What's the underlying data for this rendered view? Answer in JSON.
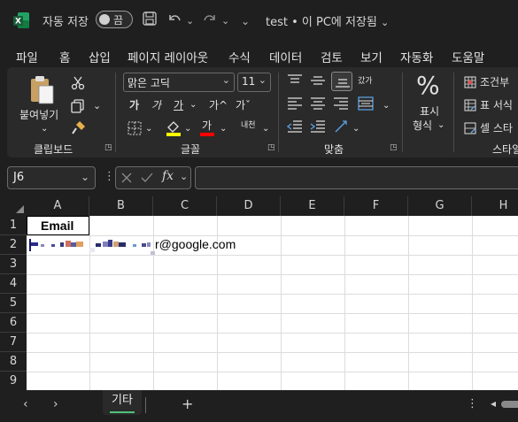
{
  "titlebar": {
    "app_icon": "excel-logo-icon",
    "autosave_label": "자동 저장",
    "autosave_state": "끔",
    "doc_title": "test • 이 PC에 저장됨",
    "title_chevron": "⌄"
  },
  "menu": {
    "tabs": [
      {
        "label": "파일"
      },
      {
        "label": "홈",
        "active": true
      },
      {
        "label": "삽입"
      },
      {
        "label": "페이지 레이아웃"
      },
      {
        "label": "수식"
      },
      {
        "label": "데이터"
      },
      {
        "label": "검토"
      },
      {
        "label": "보기"
      },
      {
        "label": "자동화"
      },
      {
        "label": "도움말"
      }
    ]
  },
  "ribbon": {
    "clipboard": {
      "paste_label": "붙여넣기",
      "group_label": "클립보드"
    },
    "font": {
      "font_name": "맑은 고딕",
      "font_size": "11",
      "bold": "가",
      "italic": "가",
      "underline": "가",
      "grow": "가^",
      "shrink": "가ˇ",
      "font_color_glyph": "가",
      "phonetic": "내천",
      "group_label": "글꼴",
      "highlight_color": "#ffff00",
      "font_color": "#ff0000"
    },
    "alignment": {
      "wrap_glyph": "갔가",
      "group_label": "맞춤"
    },
    "number": {
      "percent": "%",
      "label_line1": "표시",
      "label_line2": "형식"
    },
    "styles": {
      "items": [
        "조건부",
        "표 서식",
        "셀 스타"
      ],
      "group_label": "스타일"
    }
  },
  "formula_bar": {
    "name_box": "J6",
    "formula": ""
  },
  "grid": {
    "columns": [
      "A",
      "B",
      "C",
      "D",
      "E",
      "F",
      "G",
      "H"
    ],
    "rows": [
      "1",
      "2",
      "3",
      "4",
      "5",
      "6",
      "7",
      "8",
      "9"
    ],
    "cells": {
      "A1": "Email",
      "C2_suffix": "r@google.com"
    }
  },
  "sheets": {
    "tabs": [
      "기타"
    ],
    "add_label": "+"
  },
  "colors": {
    "accent": "#4fc27b",
    "excel_green": "#107c41"
  }
}
